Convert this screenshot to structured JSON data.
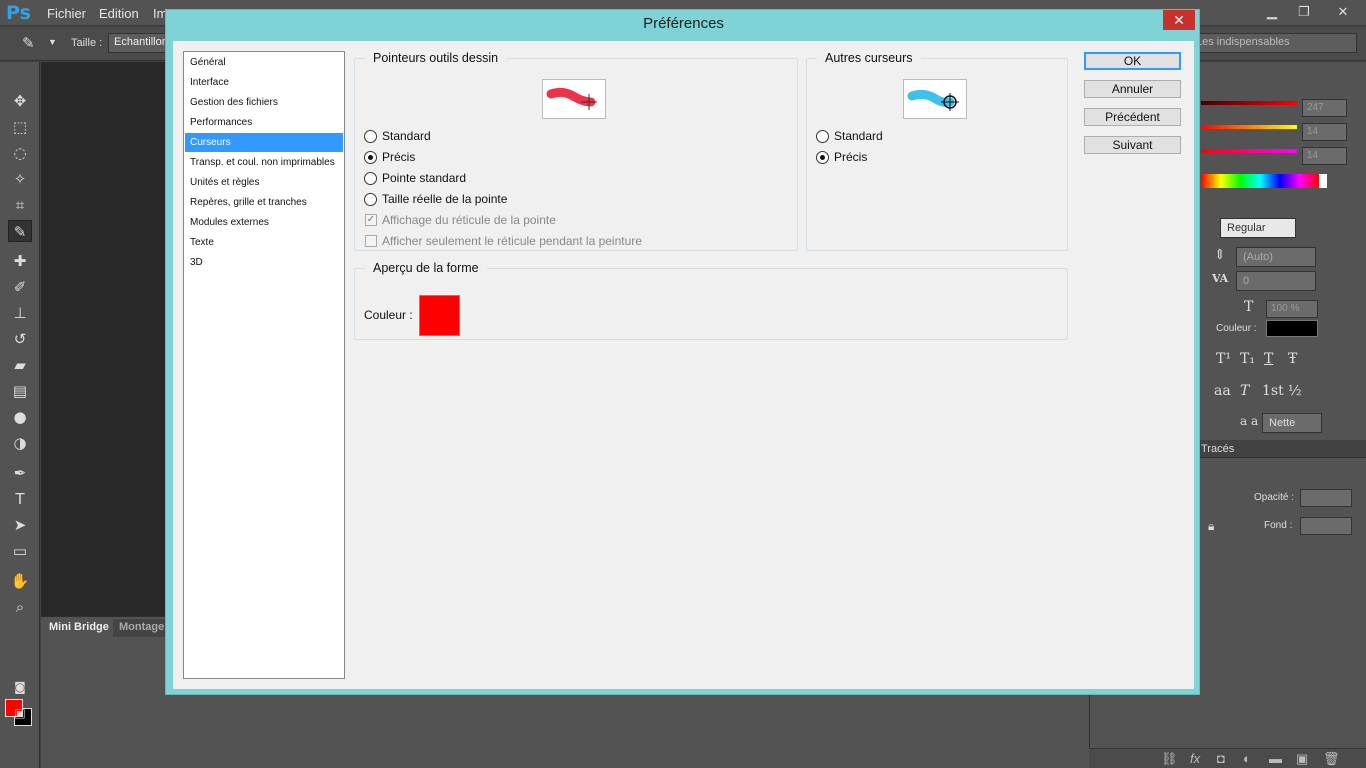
{
  "app": {
    "logo": "Ps",
    "menu": [
      "Fichier",
      "Edition",
      "Im"
    ]
  },
  "options_bar": {
    "size_label": "Taille :",
    "sample_value": "Echantillon",
    "workspace": "Les indispensables"
  },
  "mini_bridge": {
    "tabs": [
      "Mini Bridge",
      "Montage"
    ]
  },
  "right_panel": {
    "color_values": [
      "247",
      "14",
      "14"
    ],
    "font_style": "Regular",
    "leading": "(Auto)",
    "tracking": "0",
    "scale": "100 %",
    "color_label": "Couleur :",
    "antialias": "Nette",
    "antialias_icon": "a a",
    "layers_tab": "Tracés",
    "opacity_label": "Opacité :",
    "fill_label": "Fond :",
    "text_style_buttons": [
      "T",
      "T¹",
      "T₁",
      "T",
      "Ŧ"
    ],
    "ot_buttons": [
      "aa",
      "T",
      "1st",
      "½"
    ],
    "colors": {
      "fg": "#ff0000",
      "bg": "#000000"
    }
  },
  "dialog": {
    "title": "Préférences",
    "close": "✕",
    "nav": [
      "Général",
      "Interface",
      "Gestion des fichiers",
      "Performances",
      "Curseurs",
      "Transp. et coul. non imprimables",
      "Unités et règles",
      "Repères, grille et tranches",
      "Modules externes",
      "Texte",
      "3D"
    ],
    "selected_nav": "Curseurs",
    "painting_cursors": {
      "legend": "Pointeurs outils dessin",
      "options": [
        "Standard",
        "Précis",
        "Pointe standard",
        "Taille réelle de la pointe"
      ],
      "selected": "Précis",
      "checkboxes": [
        {
          "label": "Affichage du réticule de la pointe",
          "checked": true,
          "enabled": false
        },
        {
          "label": "Afficher seulement le réticule pendant la peinture",
          "checked": false,
          "enabled": false
        }
      ]
    },
    "other_cursors": {
      "legend": "Autres curseurs",
      "options": [
        "Standard",
        "Précis"
      ],
      "selected": "Précis"
    },
    "shape_preview": {
      "legend": "Aperçu de la forme",
      "color_label": "Couleur :",
      "color": "#ff0000"
    },
    "buttons": [
      "OK",
      "Annuler",
      "Précédent",
      "Suivant"
    ]
  }
}
